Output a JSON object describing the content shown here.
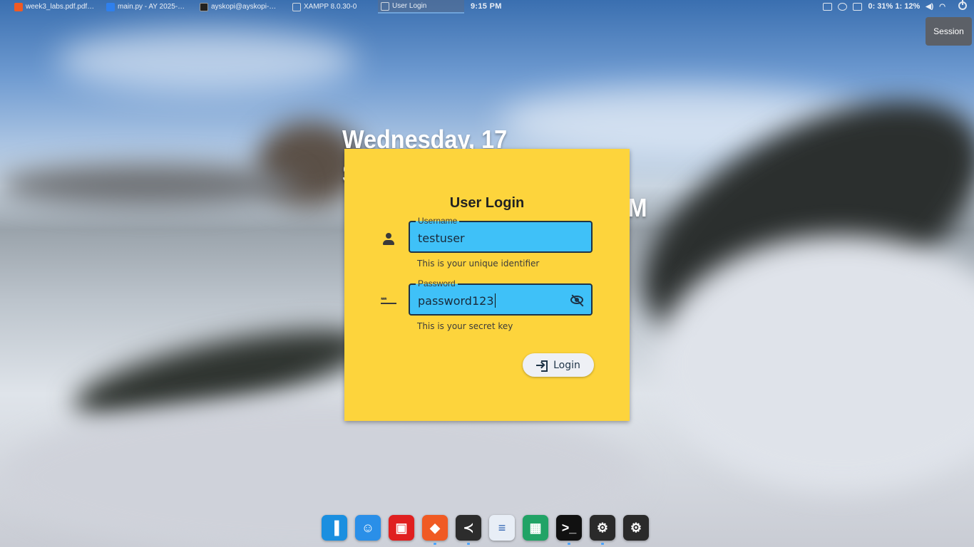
{
  "taskbar": {
    "tasks": [
      {
        "label": "week3_labs.pdf.pdf…",
        "icon": "brave-icon",
        "color": "#f05a23"
      },
      {
        "label": "main.py - AY 2025-…",
        "icon": "vscode-icon",
        "color": "#2f80ed"
      },
      {
        "label": "ayskopi@ayskopi-…",
        "icon": "terminal-icon",
        "color": "#222222"
      },
      {
        "label": "XAMPP 8.0.30-0",
        "icon": "window-icon",
        "color": "#8a8f99"
      },
      {
        "label": "User Login",
        "icon": "window-icon",
        "color": "#8a8f99"
      }
    ],
    "clock": "9:15 PM",
    "tray_status": "0: 31%  1: 12%"
  },
  "session_label": "Session",
  "desktop_date": {
    "line1": "Wednesday, 17 September,",
    "line2": "M"
  },
  "login": {
    "title": "User Login",
    "username": {
      "label": "Username",
      "value": "testuser",
      "helper": "This is your unique identifier"
    },
    "password": {
      "label": "Password",
      "value": "password123",
      "helper": "This is your secret key"
    },
    "button_label": "Login"
  },
  "colors": {
    "card_bg": "#fdd43c",
    "field_bg": "#3fc1f8",
    "field_border": "#1e3347"
  },
  "dock": [
    {
      "name": "lxqt-app-icon",
      "glyph": "▐",
      "bg": "#1a8fe0",
      "active": false
    },
    {
      "name": "finder-icon",
      "glyph": "☺",
      "bg": "#2a8fe8",
      "active": false
    },
    {
      "name": "flashcards-icon",
      "glyph": "▣",
      "bg": "#e02020",
      "active": false
    },
    {
      "name": "brave-icon",
      "glyph": "◆",
      "bg": "#f05a23",
      "active": true
    },
    {
      "name": "vscode-icon",
      "glyph": "≺",
      "bg": "#2c2c2c",
      "active": true
    },
    {
      "name": "document-icon",
      "glyph": "≡",
      "bg": "#e8eef6",
      "active": false
    },
    {
      "name": "spreadsheet-icon",
      "glyph": "▦",
      "bg": "#21a366",
      "active": false
    },
    {
      "name": "terminal-icon",
      "glyph": ">_",
      "bg": "#111111",
      "active": true
    },
    {
      "name": "settings-icon",
      "glyph": "⚙",
      "bg": "#2a2a2a",
      "active": true
    },
    {
      "name": "settings-alt-icon",
      "glyph": "⚙",
      "bg": "#2a2a2a",
      "active": false
    }
  ]
}
